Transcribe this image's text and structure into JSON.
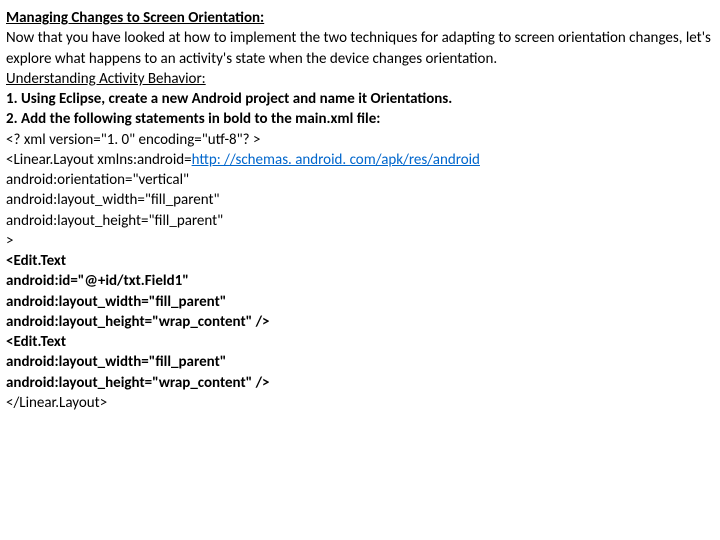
{
  "title": "Managing Changes to Screen Orientation:",
  "para": "Now that you have looked at how to implement the two techniques for adapting to screen orientation changes, let's explore what happens to an activity's state when the device changes orientation.",
  "sub": "Understanding Activity Behavior:",
  "step1": "1. Using Eclipse, create a new Android project and name it Orientations.",
  "step2": "2. Add the following statements in bold to the main.xml file:",
  "l1": "<? xml version=\"1. 0\" encoding=\"utf-8\"? >",
  "l2a": "<Linear.Layout xmlns:android=",
  "l2b": "http: //schemas. android. com/apk/res/android",
  "l3": "android:orientation=\"vertical\"",
  "l4": "android:layout_width=\"fill_parent\"",
  "l5": "android:layout_height=\"fill_parent\"",
  "l6": ">",
  "b1": "<Edit.Text",
  "b2": "android:id=\"@+id/txt.Field1\"",
  "b3": "android:layout_width=\"fill_parent\"",
  "b4": "android:layout_height=\"wrap_content\" />",
  "b5": "<Edit.Text",
  "b6": "android:layout_width=\"fill_parent\"",
  "b7": "android:layout_height=\"wrap_content\" />",
  "l7": "</Linear.Layout>"
}
